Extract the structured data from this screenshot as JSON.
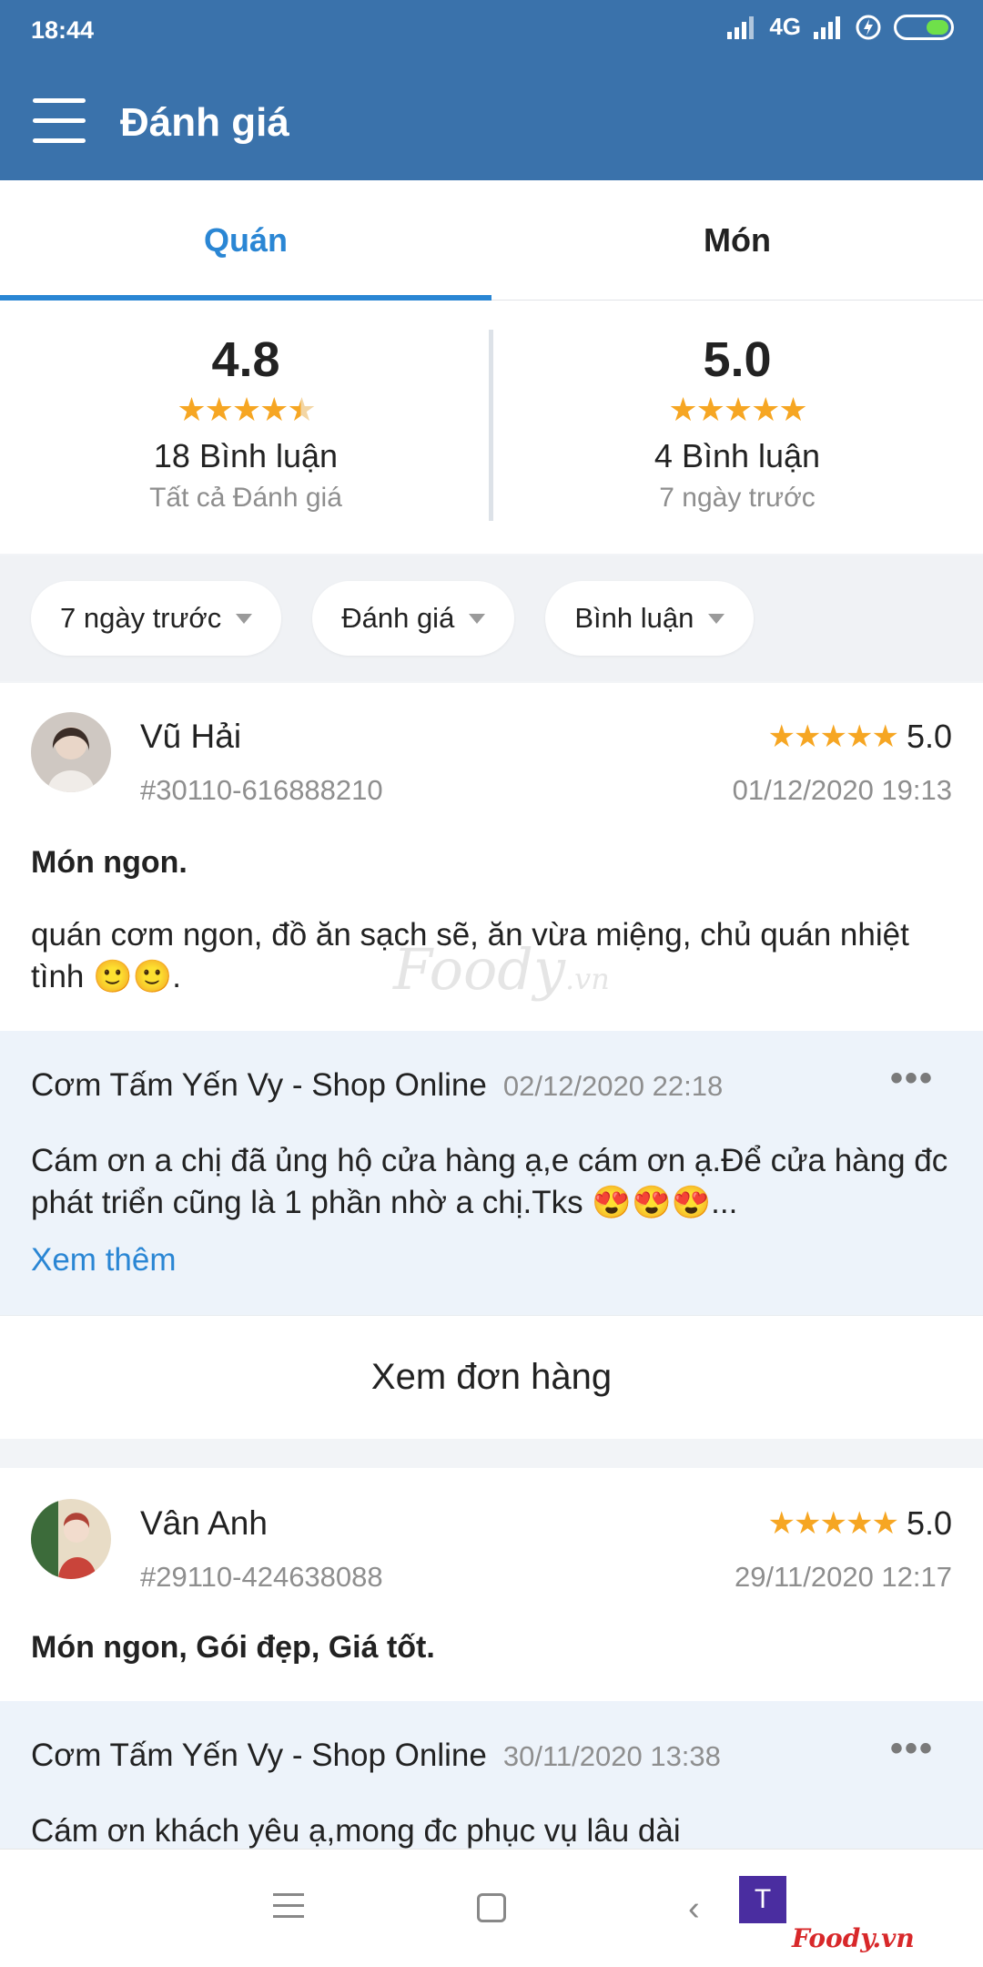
{
  "status_bar": {
    "time": "18:44",
    "network": "4G"
  },
  "header": {
    "title": "Đánh giá"
  },
  "tabs": [
    {
      "label": "Quán",
      "active": true
    },
    {
      "label": "Món",
      "active": false
    }
  ],
  "summary": {
    "left": {
      "score": "4.8",
      "stars": 4.5,
      "count": "18 Bình luận",
      "sub": "Tất cả Đánh giá"
    },
    "right": {
      "score": "5.0",
      "stars": 5,
      "count": "4 Bình luận",
      "sub": "7 ngày trước"
    }
  },
  "filters": [
    "7 ngày trước",
    "Đánh giá",
    "Bình luận"
  ],
  "reviews": [
    {
      "name": "Vũ Hải",
      "id": "#30110-616888210",
      "rating": "5.0",
      "date": "01/12/2020 19:13",
      "title": "Món ngon.",
      "body": "quán cơm ngon, đồ ăn sạch sẽ, ăn vừa miệng, chủ quán nhiệt tình 🙂🙂.",
      "reply": {
        "shop": "Cơm Tấm Yến Vy - Shop Online",
        "date": "02/12/2020 22:18",
        "text": "Cám ơn a chị đã ủng hộ cửa hàng ạ,e cám ơn ạ.Để cửa hàng đc phát triển cũng là 1 phần nhờ a chị.Tks 😍😍😍...",
        "more": "Xem thêm"
      },
      "order_button": "Xem đơn hàng"
    },
    {
      "name": "Vân Anh",
      "id": "#29110-424638088",
      "rating": "5.0",
      "date": "29/11/2020 12:17",
      "title": "Món ngon, Gói đẹp, Giá tốt.",
      "reply": {
        "shop": "Cơm Tấm Yến Vy - Shop Online",
        "date": "30/11/2020 13:38",
        "text": "Cám ơn khách yêu ạ,mong đc phục vụ lâu dài"
      }
    }
  ],
  "watermark": {
    "text": "Foody",
    "suffix": ".vn"
  },
  "brand": {
    "letter": "T",
    "name": "Foody.vn"
  },
  "colors": {
    "header": "#3a72ab",
    "accent": "#2a86d4",
    "star": "#f6a623",
    "reply_bg": "#edf3fa"
  }
}
